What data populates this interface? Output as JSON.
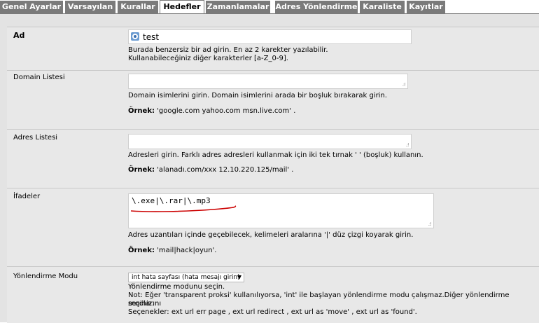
{
  "tabs": [
    {
      "label": "Genel Ayarlar"
    },
    {
      "label": "Varsayılan"
    },
    {
      "label": "Kurallar"
    },
    {
      "label": "Hedefler"
    },
    {
      "label": "Zamanlamalar"
    },
    {
      "label": "Adres Yönlendirme"
    },
    {
      "label": "Karaliste"
    },
    {
      "label": "Kayıtlar"
    }
  ],
  "ad": {
    "label": "Ad",
    "value": "test",
    "desc1": "Burada benzersiz bir ad girin. En az 2 karekter yazılabilir.",
    "desc2": "Kullanabileceğiniz diğer karakterler [a-Z_0-9]."
  },
  "domain": {
    "label": "Domain Listesi",
    "value": "",
    "desc": "Domain isimlerini girin. Domain isimlerini arada bir boşluk bırakarak girin.",
    "example_label": "Örnek:",
    "example_value": " 'google.com yahoo.com msn.live.com' ."
  },
  "adres": {
    "label": "Adres Listesi",
    "value": "",
    "desc": "Adresleri girin. Farklı adres adresleri kullanmak için iki tek tırnak ' ' (boşluk) kullanın.",
    "example_label": "Örnek:",
    "example_value": " 'alanadı.com/xxx 12.10.220.125/mail' ."
  },
  "ifadeler": {
    "label": "İfadeler",
    "value": "\\.exe|\\.rar|\\.mp3",
    "desc": "Adres uzantıları içinde geçebilecek, kelimeleri aralarına '|' düz çizgi koyarak girin.",
    "example_label": "Örnek:",
    "example_value": " 'mail|hack|oyun'."
  },
  "mode": {
    "label": "Yönlendirme Modu",
    "selected": "int hata sayfası (hata mesajı girin)",
    "desc1": "Yönlendirme modunu seçin.",
    "desc2": "Not: Eğer 'transparent proksi' kullanılıyorsa, 'int' ile başlayan yönlendirme modu çalışmaz.Diğer yönlendirme modlarını",
    "desc3": "seçiniz.",
    "desc4": "Seçenekler: ext url err page , ext url redirect , ext url as 'move' , ext url as 'found'."
  },
  "colors": {
    "tab_bg": "#7a7a7a",
    "content_bg": "#e3e3e3",
    "annotation": "#cc0000"
  }
}
